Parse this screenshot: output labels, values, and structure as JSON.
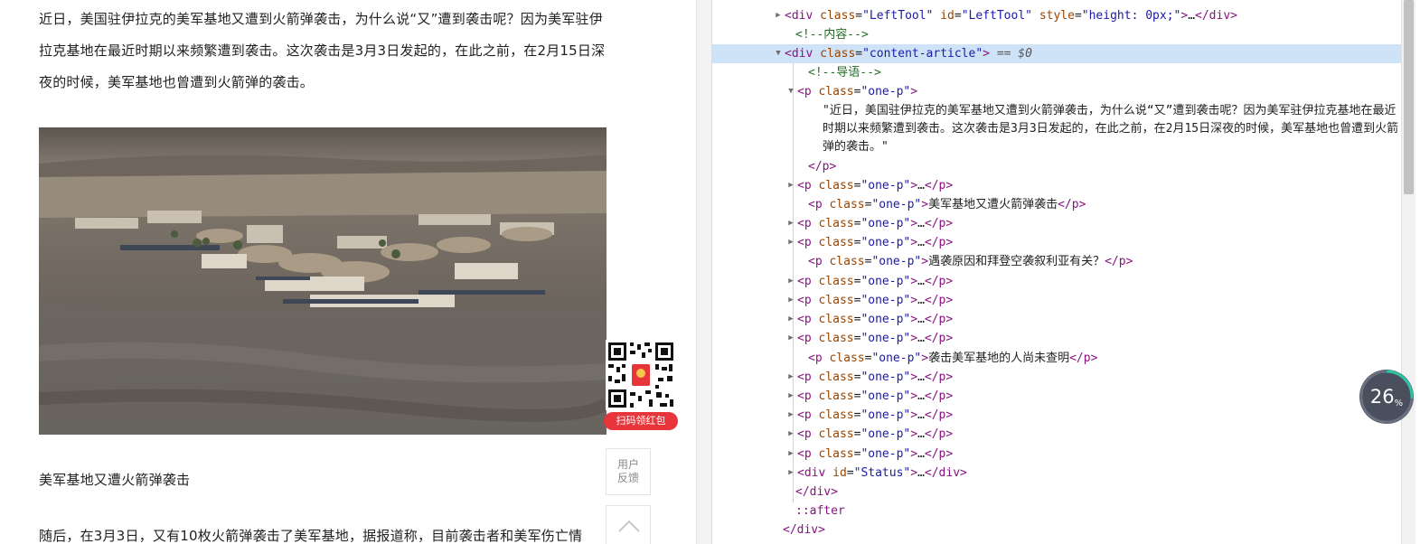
{
  "article": {
    "intro_paragraph": "近日，美国驻伊拉克的美军基地又遭到火箭弹袭击，为什么说“又”遭到袭击呢？因为美军驻伊拉克基地在最近时期以来频繁遭到袭击。这次袭击是3月3日发起的，在此之前，在2月15日深夜的时候，美军基地也曾遭到火箭弹的袭击。",
    "subheading_1": "美军基地又遭火箭弹袭击",
    "body_partial": "随后，在3月3日，又有10枚火箭弹袭击了美军基地，据报道称，目前袭击者和美军伤亡情"
  },
  "qr_promo": {
    "caption": "扫码领红包"
  },
  "side_tools": {
    "feedback_line1": "用户",
    "feedback_line2": "反馈"
  },
  "devtools": {
    "rows": [
      {
        "type": "open_collapsed",
        "tag": "div",
        "attrs": [
          [
            "class",
            "LeftTool"
          ],
          [
            "id",
            "LeftTool"
          ],
          [
            "style",
            "height: 0px;"
          ]
        ],
        "ellipsis": "…",
        "closing": "</div>"
      },
      {
        "type": "comment",
        "text": "<!--内容-->"
      },
      {
        "type": "selected",
        "tag": "div",
        "attrs": [
          [
            "class",
            "content-article"
          ]
        ],
        "suffix": " == $0"
      },
      {
        "type": "comment",
        "text": "<!--导语-->"
      },
      {
        "type": "open_expanded",
        "tag": "p",
        "attrs": [
          [
            "class",
            "one-p"
          ]
        ]
      },
      {
        "type": "close",
        "text": "</p>"
      },
      {
        "type": "collapsed_p",
        "tag": "p",
        "attrs": [
          [
            "class",
            "one-p"
          ]
        ],
        "inner": "…",
        "closing": "</p>"
      },
      {
        "type": "text_p",
        "tag": "p",
        "attrs": [
          [
            "class",
            "one-p"
          ]
        ],
        "inner": "美军基地又遭火箭弹袭击",
        "closing": "</p>"
      },
      {
        "type": "collapsed_p",
        "tag": "p",
        "attrs": [
          [
            "class",
            "one-p"
          ]
        ],
        "inner": "…",
        "closing": "</p>"
      },
      {
        "type": "collapsed_p",
        "tag": "p",
        "attrs": [
          [
            "class",
            "one-p"
          ]
        ],
        "inner": "…",
        "closing": "</p>"
      },
      {
        "type": "text_p",
        "tag": "p",
        "attrs": [
          [
            "class",
            "one-p"
          ]
        ],
        "inner": "遇袭原因和拜登空袭叙利亚有关？",
        "closing": "</p>"
      },
      {
        "type": "collapsed_p",
        "tag": "p",
        "attrs": [
          [
            "class",
            "one-p"
          ]
        ],
        "inner": "…",
        "closing": "</p>"
      },
      {
        "type": "collapsed_p",
        "tag": "p",
        "attrs": [
          [
            "class",
            "one-p"
          ]
        ],
        "inner": "…",
        "closing": "</p>"
      },
      {
        "type": "collapsed_p",
        "tag": "p",
        "attrs": [
          [
            "class",
            "one-p"
          ]
        ],
        "inner": "…",
        "closing": "</p>"
      },
      {
        "type": "collapsed_p",
        "tag": "p",
        "attrs": [
          [
            "class",
            "one-p"
          ]
        ],
        "inner": "…",
        "closing": "</p>"
      },
      {
        "type": "text_p",
        "tag": "p",
        "attrs": [
          [
            "class",
            "one-p"
          ]
        ],
        "inner": "袭击美军基地的人尚未查明",
        "closing": "</p>"
      },
      {
        "type": "collapsed_p",
        "tag": "p",
        "attrs": [
          [
            "class",
            "one-p"
          ]
        ],
        "inner": "…",
        "closing": "</p>"
      },
      {
        "type": "collapsed_p",
        "tag": "p",
        "attrs": [
          [
            "class",
            "one-p"
          ]
        ],
        "inner": "…",
        "closing": "</p>"
      },
      {
        "type": "collapsed_p",
        "tag": "p",
        "attrs": [
          [
            "class",
            "one-p"
          ]
        ],
        "inner": "…",
        "closing": "</p>"
      },
      {
        "type": "collapsed_p",
        "tag": "p",
        "attrs": [
          [
            "class",
            "one-p"
          ]
        ],
        "inner": "…",
        "closing": "</p>"
      },
      {
        "type": "collapsed_p",
        "tag": "p",
        "attrs": [
          [
            "class",
            "one-p"
          ]
        ],
        "inner": "…",
        "closing": "</p>"
      },
      {
        "type": "collapsed_div",
        "tag": "div",
        "attrs": [
          [
            "id",
            "Status"
          ]
        ],
        "inner": "…",
        "closing": "</div>"
      },
      {
        "type": "close",
        "text": "</div>"
      },
      {
        "type": "pseudo",
        "text": "::after"
      },
      {
        "type": "close",
        "text": "</div>"
      }
    ],
    "text_node": "\"近日，美国驻伊拉克的美军基地又遭到火箭弹袭击，为什么说“又”遭到袭击呢？因为美军驻伊拉克基地在最近时期以来频繁遭到袭击。这次袭击是3月3日发起的，在此之前，在2月15日深夜的时候，美军基地也曾遭到火箭弹的袭击。\""
  },
  "progress": {
    "value": "26",
    "unit": "%",
    "fraction": 0.26
  },
  "colors": {
    "tag": "#881280",
    "attr": "#994500",
    "value": "#1a1aa6",
    "comment": "#236e25",
    "selected_bg": "#cfe3f8",
    "badge": "#4a4f5e",
    "promo_red": "#e8353b"
  }
}
